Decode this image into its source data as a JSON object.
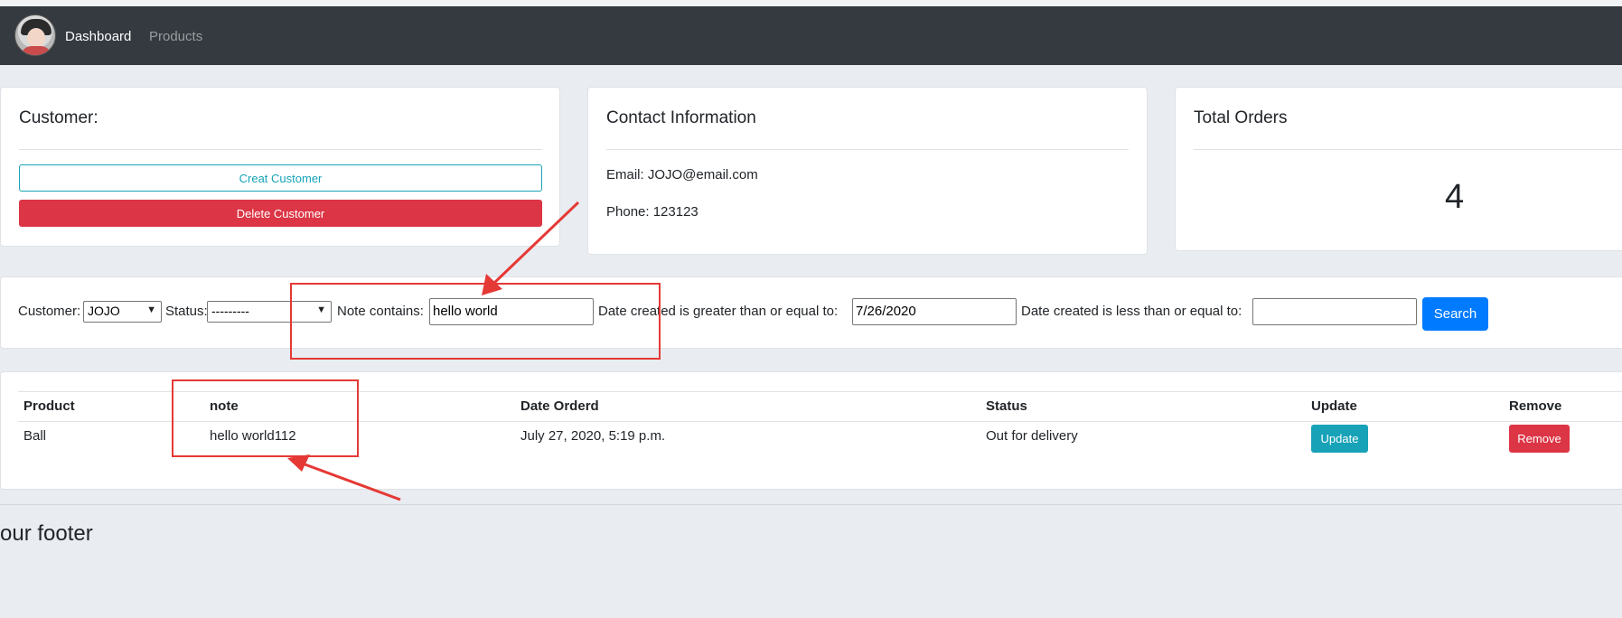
{
  "nav": {
    "dashboard": "Dashboard",
    "products": "Products"
  },
  "customer_card": {
    "title": "Customer:",
    "create_label": "Creat Customer",
    "delete_label": "Delete Customer"
  },
  "contact_card": {
    "title": "Contact Information",
    "email": "Email: JOJO@email.com",
    "phone": "Phone: 123123"
  },
  "orders_card": {
    "title": "Total Orders",
    "count": "4"
  },
  "filter": {
    "customer_label": "Customer:",
    "customer_value": "JOJO",
    "status_label": "Status:",
    "status_value": "---------",
    "note_label": "Note contains:",
    "note_value": "hello world",
    "date_gte_label": "Date created is greater than or equal to:",
    "date_gte_value": "7/26/2020",
    "date_lte_label": "Date created is less than or equal to:",
    "date_lte_value": "",
    "search_label": "Search"
  },
  "table": {
    "headers": [
      "Product",
      "note",
      "Date Orderd",
      "Status",
      "Update",
      "Remove"
    ],
    "rows": [
      {
        "product": "Ball",
        "note": "hello world112",
        "date": "July 27, 2020, 5:19 p.m.",
        "status": "Out for delivery",
        "update_label": "Update",
        "remove_label": "Remove"
      }
    ]
  },
  "footer": {
    "text": "our footer"
  },
  "colors": {
    "navbar": "#343a40",
    "background": "#e9ecf1",
    "info": "#17a2b8",
    "danger": "#dc3545",
    "primary": "#007bff",
    "annotation": "#e53935"
  }
}
